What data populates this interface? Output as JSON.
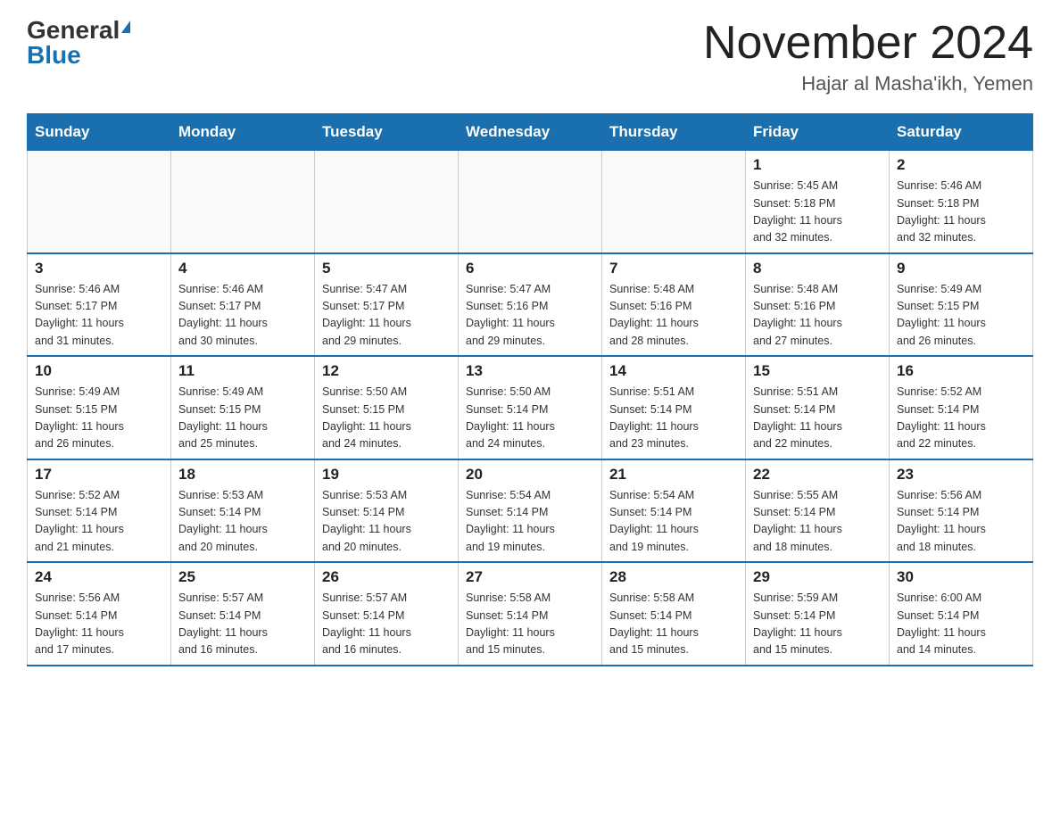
{
  "header": {
    "logo_general": "General",
    "logo_blue": "Blue",
    "month_title": "November 2024",
    "location": "Hajar al Masha'ikh, Yemen"
  },
  "calendar": {
    "days_of_week": [
      "Sunday",
      "Monday",
      "Tuesday",
      "Wednesday",
      "Thursday",
      "Friday",
      "Saturday"
    ],
    "weeks": [
      [
        {
          "day": "",
          "info": ""
        },
        {
          "day": "",
          "info": ""
        },
        {
          "day": "",
          "info": ""
        },
        {
          "day": "",
          "info": ""
        },
        {
          "day": "",
          "info": ""
        },
        {
          "day": "1",
          "info": "Sunrise: 5:45 AM\nSunset: 5:18 PM\nDaylight: 11 hours\nand 32 minutes."
        },
        {
          "day": "2",
          "info": "Sunrise: 5:46 AM\nSunset: 5:18 PM\nDaylight: 11 hours\nand 32 minutes."
        }
      ],
      [
        {
          "day": "3",
          "info": "Sunrise: 5:46 AM\nSunset: 5:17 PM\nDaylight: 11 hours\nand 31 minutes."
        },
        {
          "day": "4",
          "info": "Sunrise: 5:46 AM\nSunset: 5:17 PM\nDaylight: 11 hours\nand 30 minutes."
        },
        {
          "day": "5",
          "info": "Sunrise: 5:47 AM\nSunset: 5:17 PM\nDaylight: 11 hours\nand 29 minutes."
        },
        {
          "day": "6",
          "info": "Sunrise: 5:47 AM\nSunset: 5:16 PM\nDaylight: 11 hours\nand 29 minutes."
        },
        {
          "day": "7",
          "info": "Sunrise: 5:48 AM\nSunset: 5:16 PM\nDaylight: 11 hours\nand 28 minutes."
        },
        {
          "day": "8",
          "info": "Sunrise: 5:48 AM\nSunset: 5:16 PM\nDaylight: 11 hours\nand 27 minutes."
        },
        {
          "day": "9",
          "info": "Sunrise: 5:49 AM\nSunset: 5:15 PM\nDaylight: 11 hours\nand 26 minutes."
        }
      ],
      [
        {
          "day": "10",
          "info": "Sunrise: 5:49 AM\nSunset: 5:15 PM\nDaylight: 11 hours\nand 26 minutes."
        },
        {
          "day": "11",
          "info": "Sunrise: 5:49 AM\nSunset: 5:15 PM\nDaylight: 11 hours\nand 25 minutes."
        },
        {
          "day": "12",
          "info": "Sunrise: 5:50 AM\nSunset: 5:15 PM\nDaylight: 11 hours\nand 24 minutes."
        },
        {
          "day": "13",
          "info": "Sunrise: 5:50 AM\nSunset: 5:14 PM\nDaylight: 11 hours\nand 24 minutes."
        },
        {
          "day": "14",
          "info": "Sunrise: 5:51 AM\nSunset: 5:14 PM\nDaylight: 11 hours\nand 23 minutes."
        },
        {
          "day": "15",
          "info": "Sunrise: 5:51 AM\nSunset: 5:14 PM\nDaylight: 11 hours\nand 22 minutes."
        },
        {
          "day": "16",
          "info": "Sunrise: 5:52 AM\nSunset: 5:14 PM\nDaylight: 11 hours\nand 22 minutes."
        }
      ],
      [
        {
          "day": "17",
          "info": "Sunrise: 5:52 AM\nSunset: 5:14 PM\nDaylight: 11 hours\nand 21 minutes."
        },
        {
          "day": "18",
          "info": "Sunrise: 5:53 AM\nSunset: 5:14 PM\nDaylight: 11 hours\nand 20 minutes."
        },
        {
          "day": "19",
          "info": "Sunrise: 5:53 AM\nSunset: 5:14 PM\nDaylight: 11 hours\nand 20 minutes."
        },
        {
          "day": "20",
          "info": "Sunrise: 5:54 AM\nSunset: 5:14 PM\nDaylight: 11 hours\nand 19 minutes."
        },
        {
          "day": "21",
          "info": "Sunrise: 5:54 AM\nSunset: 5:14 PM\nDaylight: 11 hours\nand 19 minutes."
        },
        {
          "day": "22",
          "info": "Sunrise: 5:55 AM\nSunset: 5:14 PM\nDaylight: 11 hours\nand 18 minutes."
        },
        {
          "day": "23",
          "info": "Sunrise: 5:56 AM\nSunset: 5:14 PM\nDaylight: 11 hours\nand 18 minutes."
        }
      ],
      [
        {
          "day": "24",
          "info": "Sunrise: 5:56 AM\nSunset: 5:14 PM\nDaylight: 11 hours\nand 17 minutes."
        },
        {
          "day": "25",
          "info": "Sunrise: 5:57 AM\nSunset: 5:14 PM\nDaylight: 11 hours\nand 16 minutes."
        },
        {
          "day": "26",
          "info": "Sunrise: 5:57 AM\nSunset: 5:14 PM\nDaylight: 11 hours\nand 16 minutes."
        },
        {
          "day": "27",
          "info": "Sunrise: 5:58 AM\nSunset: 5:14 PM\nDaylight: 11 hours\nand 15 minutes."
        },
        {
          "day": "28",
          "info": "Sunrise: 5:58 AM\nSunset: 5:14 PM\nDaylight: 11 hours\nand 15 minutes."
        },
        {
          "day": "29",
          "info": "Sunrise: 5:59 AM\nSunset: 5:14 PM\nDaylight: 11 hours\nand 15 minutes."
        },
        {
          "day": "30",
          "info": "Sunrise: 6:00 AM\nSunset: 5:14 PM\nDaylight: 11 hours\nand 14 minutes."
        }
      ]
    ]
  }
}
